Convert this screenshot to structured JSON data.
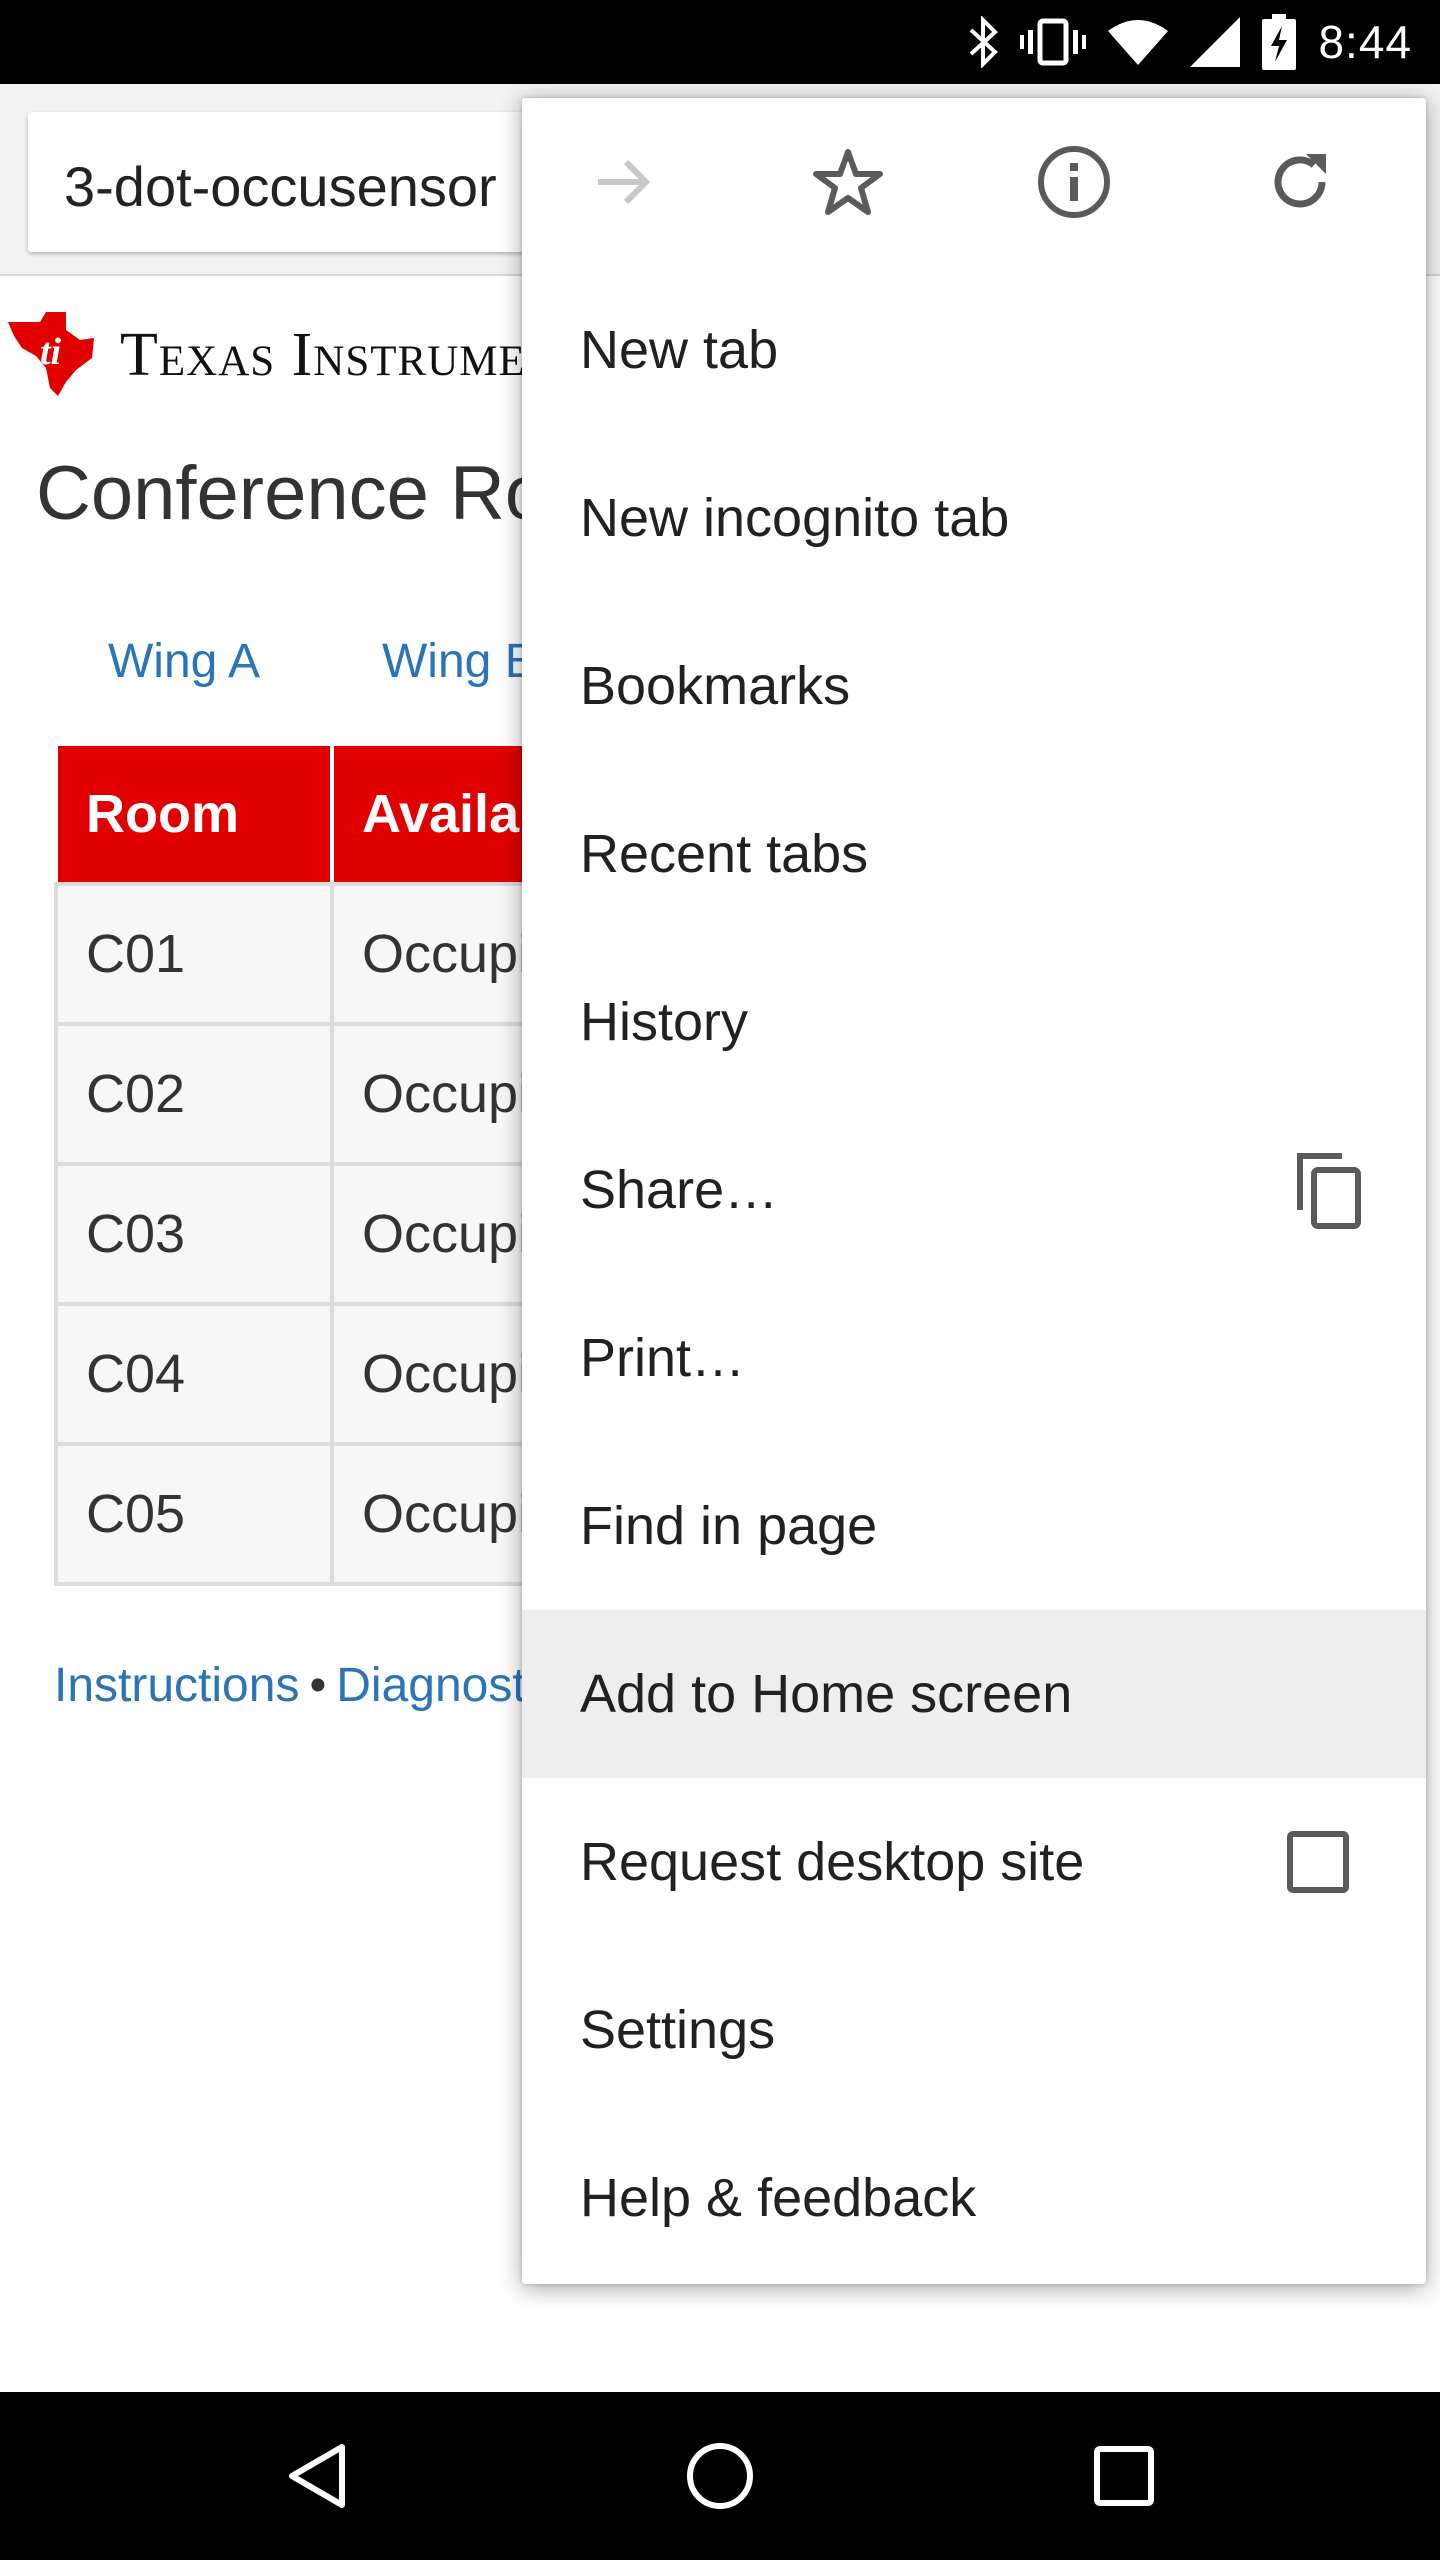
{
  "status_bar": {
    "time": "8:44",
    "icons": [
      "bluetooth-icon",
      "vibrate-icon",
      "wifi-icon",
      "cell-signal-icon",
      "battery-charging-icon"
    ]
  },
  "browser": {
    "url": "3-dot-occusensor"
  },
  "page": {
    "brand": "Texas Instruments",
    "title": "Conference Rooms",
    "wing_tabs": [
      "Wing A",
      "Wing B"
    ],
    "table": {
      "headers": [
        "Room",
        "Availability"
      ],
      "rows": [
        {
          "room": "C01",
          "status": "Occupied"
        },
        {
          "room": "C02",
          "status": "Occupied"
        },
        {
          "room": "C03",
          "status": "Occupied"
        },
        {
          "room": "C04",
          "status": "Occupied"
        },
        {
          "room": "C05",
          "status": "Occupied"
        }
      ]
    },
    "footer": {
      "link1": "Instructions",
      "separator": "•",
      "link2": "Diagnostics"
    }
  },
  "menu": {
    "icon_row": [
      "forward-arrow-icon",
      "bookmark-star-icon",
      "page-info-icon",
      "reload-icon"
    ],
    "items": [
      {
        "label": "New tab"
      },
      {
        "label": "New incognito tab"
      },
      {
        "label": "Bookmarks"
      },
      {
        "label": "Recent tabs"
      },
      {
        "label": "History"
      },
      {
        "label": "Share…",
        "trail_icon": "copy-icon"
      },
      {
        "label": "Print…"
      },
      {
        "label": "Find in page"
      },
      {
        "label": "Add to Home screen",
        "highlighted": true
      },
      {
        "label": "Request desktop site",
        "checkbox": false
      },
      {
        "label": "Settings"
      },
      {
        "label": "Help & feedback"
      }
    ]
  },
  "nav_bar": {
    "buttons": [
      "back-triangle-icon",
      "home-circle-icon",
      "recents-square-icon"
    ]
  },
  "colors": {
    "ti_red": "#e10000",
    "link_blue": "#2a74b8",
    "menu_highlight": "#eeeeee"
  }
}
